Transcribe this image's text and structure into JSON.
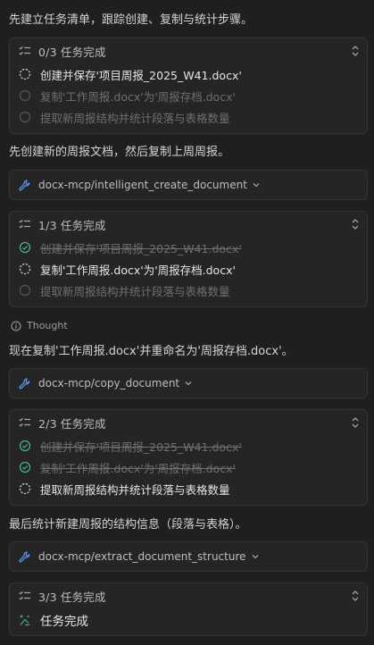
{
  "messages": {
    "m1": "先建立任务清单，跟踪创建、复制与统计步骤。",
    "m2": "先创建新的周报文档，然后复制上周周报。",
    "m3": "现在复制'工作周报.docx'并重命名为'周报存档.docx'。",
    "m4": "最后统计新建周报的结构信息（段落与表格）。"
  },
  "thought_label": "Thought",
  "todo_lists": [
    {
      "title": "0/3 任务完成",
      "items": [
        {
          "label": "创建并保存'项目周报_2025_W41.docx'",
          "status": "in-progress"
        },
        {
          "label": "复制'工作周报.docx'为'周报存档.docx'",
          "status": "pending"
        },
        {
          "label": "提取新周报结构并统计段落与表格数量",
          "status": "pending"
        }
      ]
    },
    {
      "title": "1/3 任务完成",
      "items": [
        {
          "label": "创建并保存'项目周报_2025_W41.docx'",
          "status": "completed"
        },
        {
          "label": "复制'工作周报.docx'为'周报存档.docx'",
          "status": "in-progress"
        },
        {
          "label": "提取新周报结构并统计段落与表格数量",
          "status": "pending"
        }
      ]
    },
    {
      "title": "2/3 任务完成",
      "items": [
        {
          "label": "创建并保存'项目周报_2025_W41.docx'",
          "status": "completed"
        },
        {
          "label": "复制'工作周报.docx'为'周报存档.docx'",
          "status": "completed"
        },
        {
          "label": "提取新周报结构并统计段落与表格数量",
          "status": "in-progress"
        }
      ]
    },
    {
      "title": "3/3 任务完成",
      "done_label": "任务完成"
    }
  ],
  "tools": {
    "t1": "docx-mcp/intelligent_create_document",
    "t2": "docx-mcp/copy_document",
    "t3": "docx-mcp/extract_document_structure"
  },
  "colors": {
    "background": "#1f1f1f",
    "card": "#252526",
    "completed_green": "#3fb27f",
    "tool_icon_blue": "#5b9ae8"
  },
  "icons": {
    "todo_header": "checklist-icon",
    "expand": "chevron-up-down-icon",
    "in_progress": "dashed-circle-icon",
    "pending": "empty-circle-icon",
    "completed": "check-circle-icon",
    "tool": "wrench-icon",
    "tool_expand": "chevron-down-icon",
    "thought": "info-circle-icon",
    "done": "sparkle-icon"
  }
}
